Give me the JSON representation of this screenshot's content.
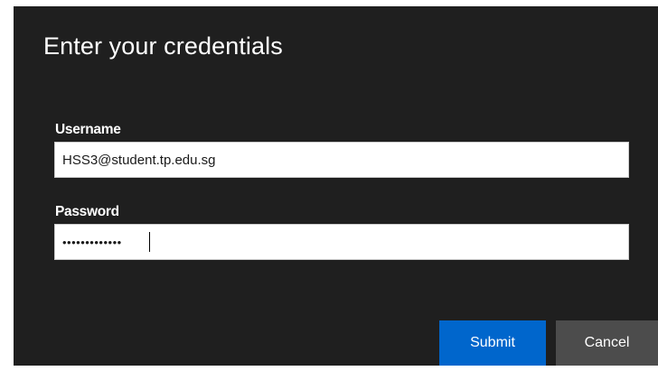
{
  "dialog": {
    "title": "Enter your credentials",
    "colors": {
      "background": "#1f1f1f",
      "primary": "#0066cc",
      "secondary": "#4c4c4c",
      "text": "#ffffff"
    }
  },
  "username": {
    "label": "Username",
    "value": "HSS3@student.tp.edu.sg"
  },
  "password": {
    "label": "Password",
    "value": "•••••••••••••"
  },
  "buttons": {
    "submit_label": "Submit",
    "cancel_label": "Cancel"
  }
}
